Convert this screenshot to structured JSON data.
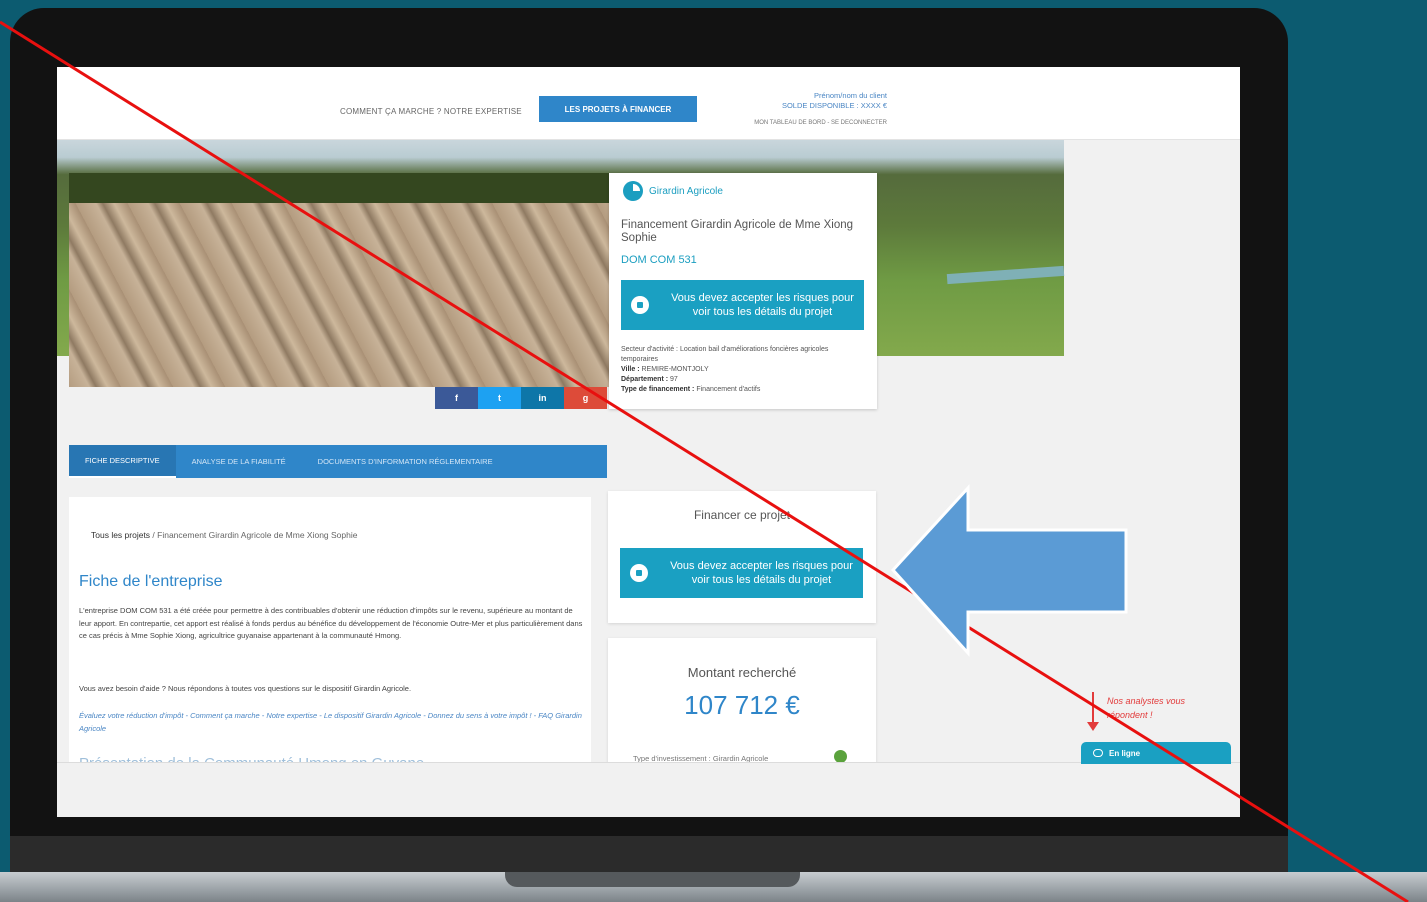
{
  "header": {
    "nav_links": "COMMENT ÇA MARCHE ?   NOTRE EXPERTISE",
    "cta": "LES PROJETS À FINANCER",
    "client_name": "Prénom/nom du client",
    "client_balance": "SOLDE DISPONIBLE : XXXX €",
    "client_links": "MON TABLEAU DE BORD - SE DECONNECTER"
  },
  "project_card": {
    "type": "Girardin Agricole",
    "title": "Financement Girardin Agricole de Mme Xiong Sophie",
    "ref": "DOM COM 531",
    "risk_button": "Vous devez accepter les risques pour voir tous les détails du projet",
    "sector_label": "Secteur d'activité :",
    "sector_value": "Location bail d'améliorations foncières agricoles temporaires",
    "city_label": "Ville :",
    "city_value": "REMIRE-MONTJOLY",
    "department_label": "Département :",
    "department_value": "97",
    "funding_label": "Type de financement :",
    "funding_value": "Financement d'actifs"
  },
  "social": {
    "facebook": "f",
    "twitter": "t",
    "linkedin": "in",
    "google": "g"
  },
  "tabs": [
    {
      "label": "FICHE DESCRIPTIVE"
    },
    {
      "label": "ANALYSE DE LA FIABILITÉ"
    },
    {
      "label": "DOCUMENTS D'INFORMATION RÉGLEMENTAIRE"
    }
  ],
  "content": {
    "breadcrumb_root": "Tous les projets",
    "breadcrumb_current": " / Financement Girardin Agricole de Mme Xiong Sophie",
    "section_title": "Fiche de l'entreprise",
    "paragraph1": "L'entreprise DOM COM 531 a été créée pour permettre à des contribuables d'obtenir une réduction d'impôts sur le revenu, supérieure au montant de leur apport. En contrepartie, cet apport est réalisé à fonds perdus au bénéfice du développement de l'économie Outre-Mer et plus particulièrement dans ce cas précis à Mme Sophie Xiong, agricultrice guyanaise appartenant à la communauté Hmong.",
    "paragraph2": "Vous avez besoin d'aide ? Nous répondons à toutes vos questions sur le dispositif Girardin Agricole.",
    "links": "Évaluez votre réduction d'impôt - Comment ça marche - Notre expertise - Le dispositif Girardin Agricole - Donnez du sens à votre impôt ! - FAQ Girardin Agricole",
    "next_section": "Présentation de la Communauté Hmong en Guyane"
  },
  "finance": {
    "title": "Financer ce projet",
    "risk_button": "Vous devez accepter les risques pour voir tous les détails du projet"
  },
  "amount": {
    "label": "Montant recherché",
    "value": "107 712 €",
    "invest_label": "Type d'investissement :",
    "invest_value": "Girardin Agricole"
  },
  "chat": {
    "annotation": "Nos analystes vous répondent !",
    "button": "En ligne"
  },
  "colors": {
    "brand_blue": "#2f86c9",
    "teal": "#1aa0c2",
    "annotation_red": "#e8100f",
    "arrow_blue": "#5b9bd5",
    "background": "#0c5b70"
  }
}
